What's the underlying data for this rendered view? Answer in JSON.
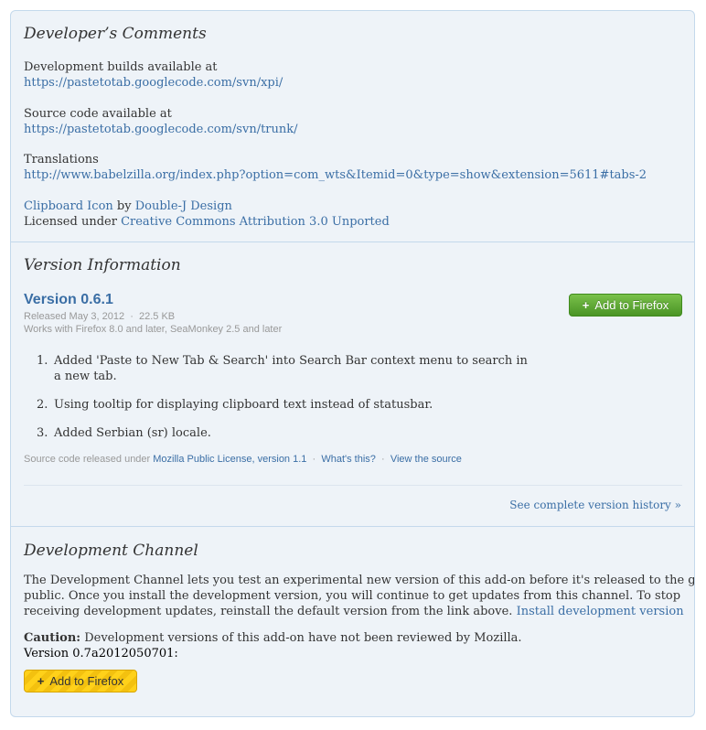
{
  "dev_comments": {
    "title": "Developer’s Comments",
    "builds_label": "Development builds available at",
    "builds_link": "https://pastetotab.googlecode.com/svn/xpi/",
    "source_label": "Source code available at",
    "source_link": "https://pastetotab.googlecode.com/svn/trunk/",
    "translations_label": "Translations",
    "translations_link": "http://www.babelzilla.org/index.php?option=com_wts&Itemid=0&type=show&extension=5611#tabs-2",
    "icon_link": "Clipboard Icon",
    "by_text": " by ",
    "designer_link": "Double-J Design",
    "licensed_text": "Licensed under ",
    "license_link": "Creative Commons Attribution 3.0 Unported"
  },
  "version_info": {
    "title": "Version Information",
    "version": "Version 0.6.1",
    "released": "Released May 3, 2012",
    "dot": "·",
    "size": "22.5 KB",
    "works_with": "Works with Firefox 8.0 and later, SeaMonkey 2.5 and later",
    "add_button": "Add to Firefox",
    "notes": [
      {
        "num": "1.",
        "text": "Added 'Paste to New Tab & Search' into Search Bar context menu to search in a new tab."
      },
      {
        "num": "2.",
        "text": "Using tooltip for displaying clipboard text instead of statusbar."
      },
      {
        "num": "3.",
        "text": "Added Serbian (sr) locale."
      }
    ],
    "license_prefix": "Source code released under ",
    "license_link": "Mozilla Public License, version 1.1",
    "whats_this": "What's this?",
    "view_source": "View the source",
    "history_link": "See complete version history »"
  },
  "dev_channel": {
    "title": "Development Channel",
    "paragraph_line1": "The Development Channel lets you test an experimental new version of this add-on before it's released to the general",
    "paragraph_line2": "public. Once you install the development version, you will continue to get updates from this channel. To stop",
    "paragraph_line3": "receiving development updates, reinstall the default version from the link above.",
    "install_link": "Install development version",
    "caution_label": "Caution:",
    "caution_text": " Development versions of this add-on have not been reviewed by Mozilla.",
    "version": "Version 0.7a2012050701:",
    "add_button": "Add to Firefox"
  },
  "colors": {
    "link": "#3a6ea5",
    "panel_bg": "#eef3f8",
    "border": "#c4d9ec",
    "green_button": "#5aa82f",
    "yellow_button": "#ffd11a"
  }
}
